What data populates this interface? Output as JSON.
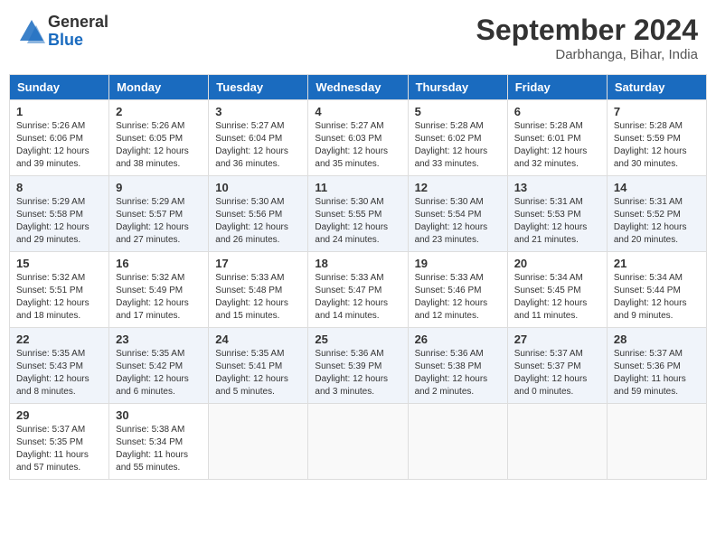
{
  "header": {
    "logo_general": "General",
    "logo_blue": "Blue",
    "month_title": "September 2024",
    "location": "Darbhanga, Bihar, India"
  },
  "days_of_week": [
    "Sunday",
    "Monday",
    "Tuesday",
    "Wednesday",
    "Thursday",
    "Friday",
    "Saturday"
  ],
  "weeks": [
    [
      {
        "day": "1",
        "sunrise": "Sunrise: 5:26 AM",
        "sunset": "Sunset: 6:06 PM",
        "daylight": "Daylight: 12 hours and 39 minutes."
      },
      {
        "day": "2",
        "sunrise": "Sunrise: 5:26 AM",
        "sunset": "Sunset: 6:05 PM",
        "daylight": "Daylight: 12 hours and 38 minutes."
      },
      {
        "day": "3",
        "sunrise": "Sunrise: 5:27 AM",
        "sunset": "Sunset: 6:04 PM",
        "daylight": "Daylight: 12 hours and 36 minutes."
      },
      {
        "day": "4",
        "sunrise": "Sunrise: 5:27 AM",
        "sunset": "Sunset: 6:03 PM",
        "daylight": "Daylight: 12 hours and 35 minutes."
      },
      {
        "day": "5",
        "sunrise": "Sunrise: 5:28 AM",
        "sunset": "Sunset: 6:02 PM",
        "daylight": "Daylight: 12 hours and 33 minutes."
      },
      {
        "day": "6",
        "sunrise": "Sunrise: 5:28 AM",
        "sunset": "Sunset: 6:01 PM",
        "daylight": "Daylight: 12 hours and 32 minutes."
      },
      {
        "day": "7",
        "sunrise": "Sunrise: 5:28 AM",
        "sunset": "Sunset: 5:59 PM",
        "daylight": "Daylight: 12 hours and 30 minutes."
      }
    ],
    [
      {
        "day": "8",
        "sunrise": "Sunrise: 5:29 AM",
        "sunset": "Sunset: 5:58 PM",
        "daylight": "Daylight: 12 hours and 29 minutes."
      },
      {
        "day": "9",
        "sunrise": "Sunrise: 5:29 AM",
        "sunset": "Sunset: 5:57 PM",
        "daylight": "Daylight: 12 hours and 27 minutes."
      },
      {
        "day": "10",
        "sunrise": "Sunrise: 5:30 AM",
        "sunset": "Sunset: 5:56 PM",
        "daylight": "Daylight: 12 hours and 26 minutes."
      },
      {
        "day": "11",
        "sunrise": "Sunrise: 5:30 AM",
        "sunset": "Sunset: 5:55 PM",
        "daylight": "Daylight: 12 hours and 24 minutes."
      },
      {
        "day": "12",
        "sunrise": "Sunrise: 5:30 AM",
        "sunset": "Sunset: 5:54 PM",
        "daylight": "Daylight: 12 hours and 23 minutes."
      },
      {
        "day": "13",
        "sunrise": "Sunrise: 5:31 AM",
        "sunset": "Sunset: 5:53 PM",
        "daylight": "Daylight: 12 hours and 21 minutes."
      },
      {
        "day": "14",
        "sunrise": "Sunrise: 5:31 AM",
        "sunset": "Sunset: 5:52 PM",
        "daylight": "Daylight: 12 hours and 20 minutes."
      }
    ],
    [
      {
        "day": "15",
        "sunrise": "Sunrise: 5:32 AM",
        "sunset": "Sunset: 5:51 PM",
        "daylight": "Daylight: 12 hours and 18 minutes."
      },
      {
        "day": "16",
        "sunrise": "Sunrise: 5:32 AM",
        "sunset": "Sunset: 5:49 PM",
        "daylight": "Daylight: 12 hours and 17 minutes."
      },
      {
        "day": "17",
        "sunrise": "Sunrise: 5:33 AM",
        "sunset": "Sunset: 5:48 PM",
        "daylight": "Daylight: 12 hours and 15 minutes."
      },
      {
        "day": "18",
        "sunrise": "Sunrise: 5:33 AM",
        "sunset": "Sunset: 5:47 PM",
        "daylight": "Daylight: 12 hours and 14 minutes."
      },
      {
        "day": "19",
        "sunrise": "Sunrise: 5:33 AM",
        "sunset": "Sunset: 5:46 PM",
        "daylight": "Daylight: 12 hours and 12 minutes."
      },
      {
        "day": "20",
        "sunrise": "Sunrise: 5:34 AM",
        "sunset": "Sunset: 5:45 PM",
        "daylight": "Daylight: 12 hours and 11 minutes."
      },
      {
        "day": "21",
        "sunrise": "Sunrise: 5:34 AM",
        "sunset": "Sunset: 5:44 PM",
        "daylight": "Daylight: 12 hours and 9 minutes."
      }
    ],
    [
      {
        "day": "22",
        "sunrise": "Sunrise: 5:35 AM",
        "sunset": "Sunset: 5:43 PM",
        "daylight": "Daylight: 12 hours and 8 minutes."
      },
      {
        "day": "23",
        "sunrise": "Sunrise: 5:35 AM",
        "sunset": "Sunset: 5:42 PM",
        "daylight": "Daylight: 12 hours and 6 minutes."
      },
      {
        "day": "24",
        "sunrise": "Sunrise: 5:35 AM",
        "sunset": "Sunset: 5:41 PM",
        "daylight": "Daylight: 12 hours and 5 minutes."
      },
      {
        "day": "25",
        "sunrise": "Sunrise: 5:36 AM",
        "sunset": "Sunset: 5:39 PM",
        "daylight": "Daylight: 12 hours and 3 minutes."
      },
      {
        "day": "26",
        "sunrise": "Sunrise: 5:36 AM",
        "sunset": "Sunset: 5:38 PM",
        "daylight": "Daylight: 12 hours and 2 minutes."
      },
      {
        "day": "27",
        "sunrise": "Sunrise: 5:37 AM",
        "sunset": "Sunset: 5:37 PM",
        "daylight": "Daylight: 12 hours and 0 minutes."
      },
      {
        "day": "28",
        "sunrise": "Sunrise: 5:37 AM",
        "sunset": "Sunset: 5:36 PM",
        "daylight": "Daylight: 11 hours and 59 minutes."
      }
    ],
    [
      {
        "day": "29",
        "sunrise": "Sunrise: 5:37 AM",
        "sunset": "Sunset: 5:35 PM",
        "daylight": "Daylight: 11 hours and 57 minutes."
      },
      {
        "day": "30",
        "sunrise": "Sunrise: 5:38 AM",
        "sunset": "Sunset: 5:34 PM",
        "daylight": "Daylight: 11 hours and 55 minutes."
      },
      null,
      null,
      null,
      null,
      null
    ]
  ]
}
